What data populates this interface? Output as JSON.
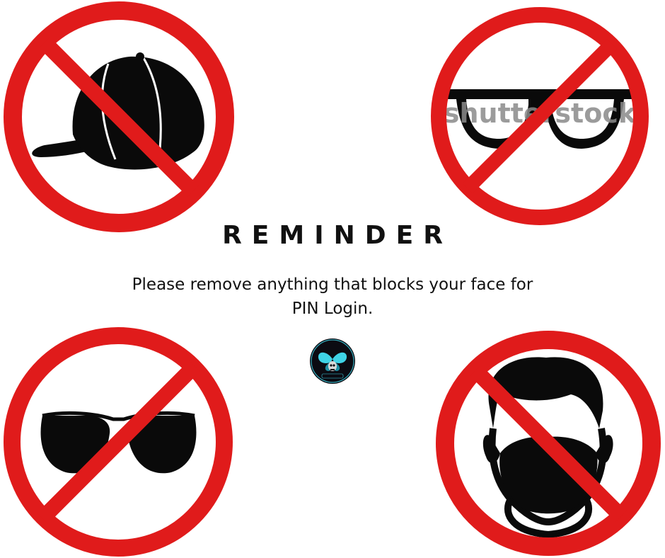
{
  "reminder": {
    "title": "REMINDER",
    "message_line1": "Please remove anything that blocks your face for",
    "message_line2": "PIN Login."
  },
  "signs": [
    {
      "item": "cap",
      "icon": "no-cap-icon"
    },
    {
      "item": "glasses",
      "icon": "no-glasses-icon",
      "watermark": "shutterstock"
    },
    {
      "item": "sunglasses",
      "icon": "no-sunglasses-icon"
    },
    {
      "item": "face-mask",
      "icon": "no-face-mask-icon"
    }
  ],
  "logo": {
    "icon": "butterfly-skull-logo",
    "ring_text": "PARO PARO G",
    "bottom_text": "PAOY GHOSTLOCK"
  },
  "colors": {
    "prohibition_red": "#e01b1b",
    "icon_black": "#0a0a0a",
    "logo_cyan": "#3fd3e6"
  }
}
